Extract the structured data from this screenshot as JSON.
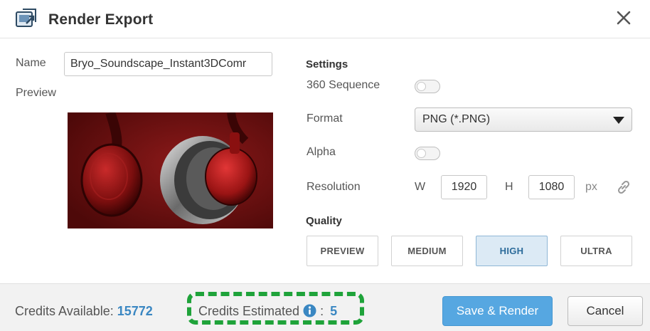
{
  "dialog": {
    "title": "Render Export",
    "icons": {
      "app": "render-app-icon",
      "close": "close-icon"
    }
  },
  "left": {
    "name_label": "Name",
    "name_value": "Bryo_Soundscape_Instant3DComr",
    "preview_label": "Preview",
    "preview_image": "red-headphones-render"
  },
  "settings": {
    "heading": "Settings",
    "sequence_label": "360 Sequence",
    "sequence_on": false,
    "format_label": "Format",
    "format_value": "PNG (*.PNG)",
    "alpha_label": "Alpha",
    "alpha_on": false,
    "resolution_label": "Resolution",
    "width_label": "W",
    "width_value": "1920",
    "height_label": "H",
    "height_value": "1080",
    "unit": "px",
    "link_icon": "link-icon"
  },
  "quality": {
    "heading": "Quality",
    "options": [
      "PREVIEW",
      "MEDIUM",
      "HIGH",
      "ULTRA"
    ],
    "selected": "HIGH"
  },
  "footer": {
    "credits_available_label": "Credits Available:",
    "credits_available_value": "15772",
    "credits_estimated_label": "Credits Estimated",
    "credits_estimated_sep": ":",
    "credits_estimated_value": "5",
    "info_icon": "info-icon",
    "save_label": "Save & Render",
    "cancel_label": "Cancel"
  },
  "colors": {
    "accent": "#3a87c2",
    "primary_button": "#56a7e1",
    "highlight_border": "#1fa33a",
    "selected_quality_bg": "#dceaf5",
    "preview_bg": "#6e0f0f"
  }
}
